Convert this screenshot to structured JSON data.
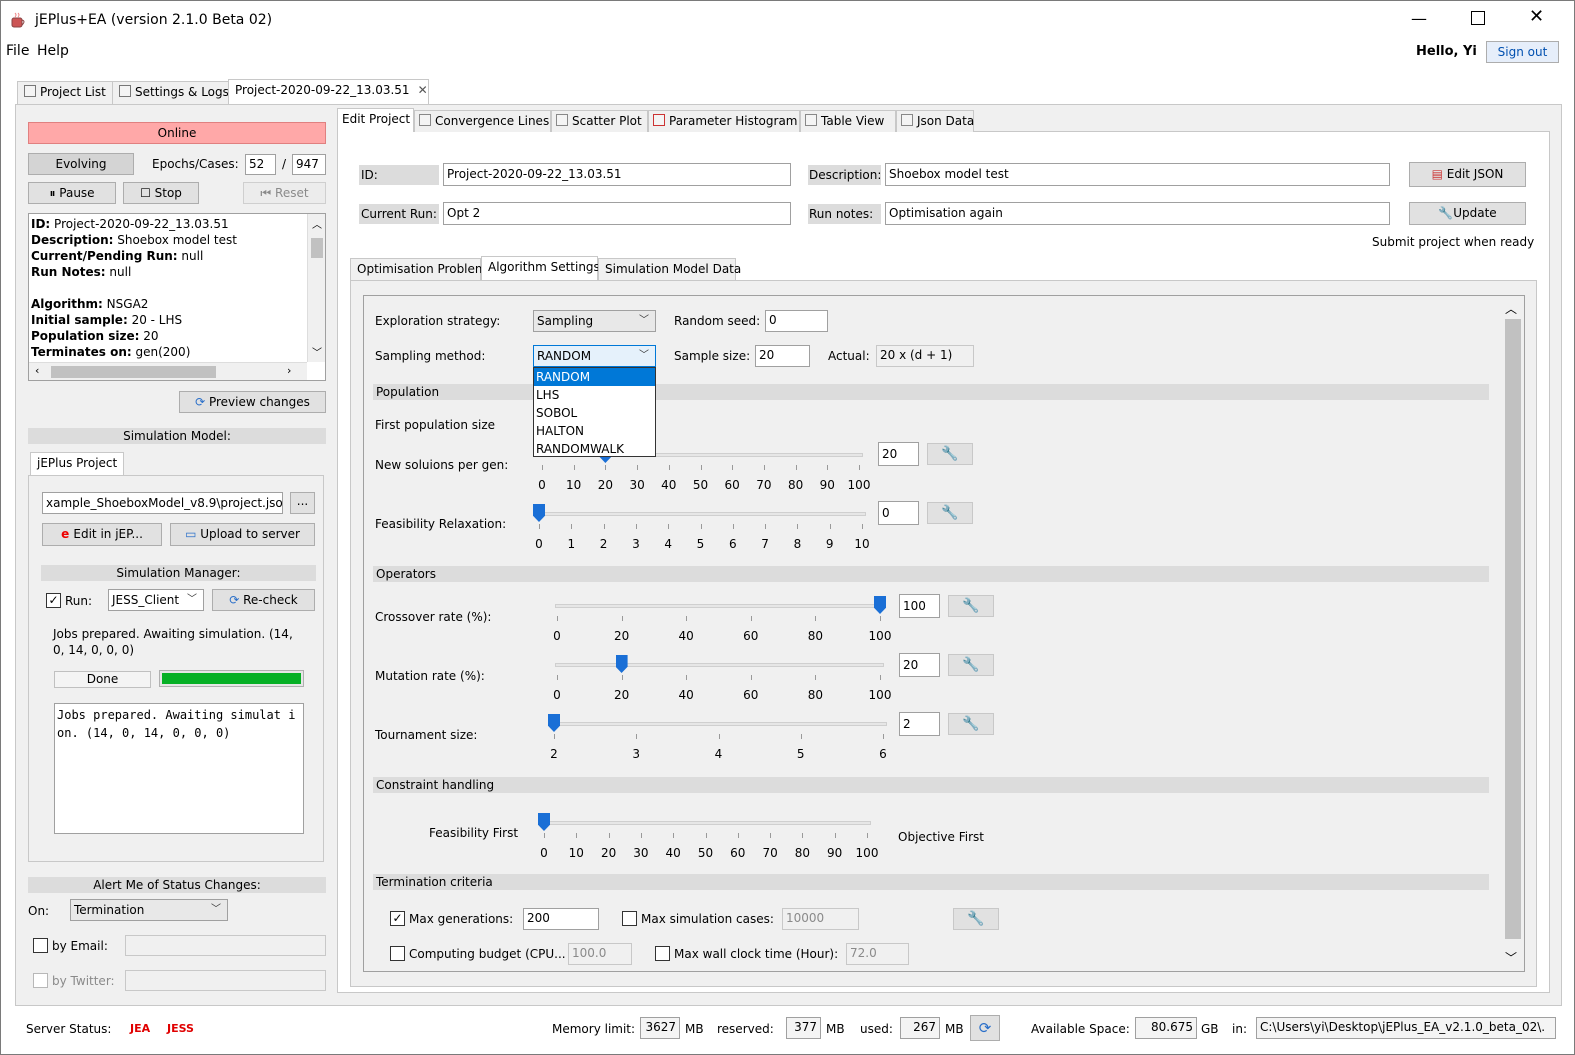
{
  "window": {
    "title": "jEPlus+EA (version 2.1.0 Beta 02)"
  },
  "menu": {
    "file": "File",
    "help": "Help",
    "greeting": "Hello, Yi",
    "signout": "Sign out"
  },
  "tabs": {
    "project_list": "Project List",
    "settings_logs": "Settings & Logs",
    "project": "Project-2020-09-22_13.03.51"
  },
  "left": {
    "status": "Online",
    "evolving": "Evolving",
    "epochs_label": "Epochs/Cases:",
    "epochs": "52",
    "sep": "/",
    "cases": "947",
    "pause": "Pause",
    "stop": "Stop",
    "reset": "Reset",
    "info": [
      {
        "k": "ID:",
        "v": " Project-2020-09-22_13.03.51"
      },
      {
        "k": "Description:",
        "v": " Shoebox model test"
      },
      {
        "k": "Current/Pending Run:",
        "v": " null"
      },
      {
        "k": "Run Notes:",
        "v": " null"
      },
      {
        "k": "",
        "v": ""
      },
      {
        "k": "Algorithm:",
        "v": " NSGA2"
      },
      {
        "k": "Initial sample:",
        "v": " 20 - LHS"
      },
      {
        "k": "Population size:",
        "v": " 20"
      },
      {
        "k": "Terminates on:",
        "v": " gen(200)"
      }
    ],
    "preview": "Preview changes",
    "sim_model": "Simulation Model:",
    "jeplus_tab": "jEPlus Project",
    "project_path": "xample_ShoeboxModel_v8.9\\project.json",
    "browse": "...",
    "edit_jep": "Edit in jEP...",
    "upload": "Upload to server",
    "sim_manager": "Simulation Manager:",
    "run": "Run:",
    "client": "JESS_Client",
    "recheck": "Re-check",
    "jobs_text": "Jobs prepared. Awaiting simulation. (14, 0, 14, 0, 0, 0)",
    "done": "Done",
    "progress": 1.0,
    "log": "Jobs prepared. Awaiting simulat ion. (14, 0, 14, 0, 0, 0)",
    "alert": "Alert Me of Status Changes:",
    "on": "On:",
    "on_value": "Termination",
    "by_email": "by Email:",
    "by_twitter": "by Twitter:"
  },
  "subtabs": [
    "Edit Project",
    "Convergence Lines",
    "Scatter Plot",
    "Parameter Histogram",
    "Table View",
    "Json Data"
  ],
  "project": {
    "id_label": "ID:",
    "id": "Project-2020-09-22_13.03.51",
    "desc_label": "Description:",
    "desc": "Shoebox model test",
    "run_label": "Current Run:",
    "run": "Opt 2",
    "notes_label": "Run notes:",
    "notes": "Optimisation again",
    "edit_json": "Edit JSON",
    "update": "Update",
    "submit": "Submit project when ready"
  },
  "inner_tabs": [
    "Optimisation Problem",
    "Algorithm Settings",
    "Simulation Model Data"
  ],
  "alg": {
    "explore_label": "Exploration strategy:",
    "explore": "Sampling",
    "seed_label": "Random seed:",
    "seed": "0",
    "method_label": "Sampling method:",
    "method": "RANDOM",
    "size_label": "Sample size:",
    "size": "20",
    "actual_label": "Actual:",
    "actual": "20 x (d + 1)",
    "dropdown": [
      "RANDOM",
      "LHS",
      "SOBOL",
      "HALTON",
      "RANDOMWALK"
    ],
    "population": "Population",
    "first_pop": "First population size",
    "new_sol": "New soluions per gen:",
    "new_sol_val": "20",
    "feas": "Feasibility Relaxation:",
    "feas_val": "0",
    "operators": "Operators",
    "cross": "Crossover rate (%):",
    "cross_val": "100",
    "mut": "Mutation rate (%):",
    "mut_val": "20",
    "tourn": "Tournament size:",
    "tourn_val": "2",
    "constraint": "Constraint handling",
    "feas_first": "Feasibility First",
    "obj_first": "Objective First",
    "termination": "Termination criteria",
    "max_gen": "Max generations:",
    "max_gen_val": "200",
    "max_sim": "Max simulation cases:",
    "max_sim_val": "10000",
    "budget": "Computing budget (CPU...",
    "budget_val": "100.0",
    "wall": "Max wall clock time (Hour):",
    "wall_val": "72.0"
  },
  "sliders": {
    "new_sol": {
      "ticks": [
        "0",
        "10",
        "20",
        "30",
        "40",
        "50",
        "60",
        "70",
        "80",
        "90",
        "100"
      ],
      "value": 20,
      "max": 100
    },
    "feas": {
      "ticks": [
        "0",
        "1",
        "2",
        "3",
        "4",
        "5",
        "6",
        "7",
        "8",
        "9",
        "10"
      ],
      "value": 0,
      "max": 10
    },
    "cross": {
      "ticks": [
        "0",
        "20",
        "40",
        "60",
        "80",
        "100"
      ],
      "value": 100,
      "max": 100
    },
    "mut": {
      "ticks": [
        "0",
        "20",
        "40",
        "60",
        "80",
        "100"
      ],
      "value": 20,
      "max": 100
    },
    "tourn": {
      "ticks": [
        "2",
        "3",
        "4",
        "5",
        "6"
      ],
      "value": 0,
      "max": 4
    },
    "constraint": {
      "ticks": [
        "0",
        "10",
        "20",
        "30",
        "40",
        "50",
        "60",
        "70",
        "80",
        "90",
        "100"
      ],
      "value": 0,
      "max": 100
    }
  },
  "status": {
    "server": "Server Status:",
    "jea": "JEA",
    "jess": "JESS",
    "mem_label": "Memory limit:",
    "mem": "3627",
    "mb": "MB",
    "res_label": "reserved:",
    "res": "377",
    "used_label": "used:",
    "used": "267",
    "avail_label": "Available Space:",
    "avail": "80.675",
    "gb": "GB",
    "in": "in:",
    "path": "C:\\Users\\yi\\Desktop\\jEPlus_EA_v2.1.0_beta_02\\."
  },
  "colors": {
    "online": "#ffa8a8",
    "accent": "#0078d7",
    "progress": "#06b025",
    "server_red": "#e00000"
  }
}
